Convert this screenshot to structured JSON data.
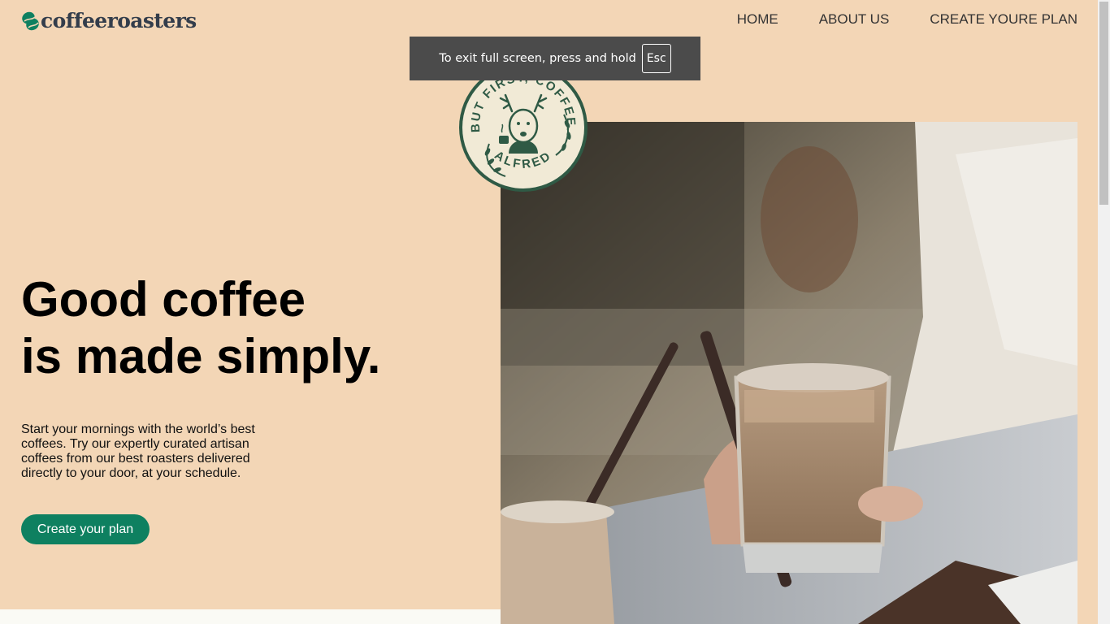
{
  "brand": {
    "name": "coffeeroasters",
    "accent": "#0e8060",
    "text_color": "#333d4b"
  },
  "nav": {
    "items": [
      "HOME",
      "ABOUT US",
      "CREATE YOURE PLAN"
    ]
  },
  "fullscreen_notice": {
    "text": "To exit full screen, press and hold",
    "key": "Esc"
  },
  "stamp": {
    "top_text": "BUT FIRST, COFFEE.",
    "bottom_text": "ALFRED",
    "icon": "deer-with-coffee-icon"
  },
  "hero": {
    "headline_line1": "Good coffee",
    "headline_line2": "is made simply.",
    "intro": "Start your mornings with the world’s best coffees. Try our expertly curated artisan coffees from our best roasters delivered directly to your door, at your schedule.",
    "cta_label": "Create your plan",
    "photo_icon": "iced-coffee-photo"
  },
  "colors": {
    "page_bg": "#f3d6b6",
    "stamp_green": "#2f5a45",
    "stamp_cream": "#f1ead6"
  }
}
